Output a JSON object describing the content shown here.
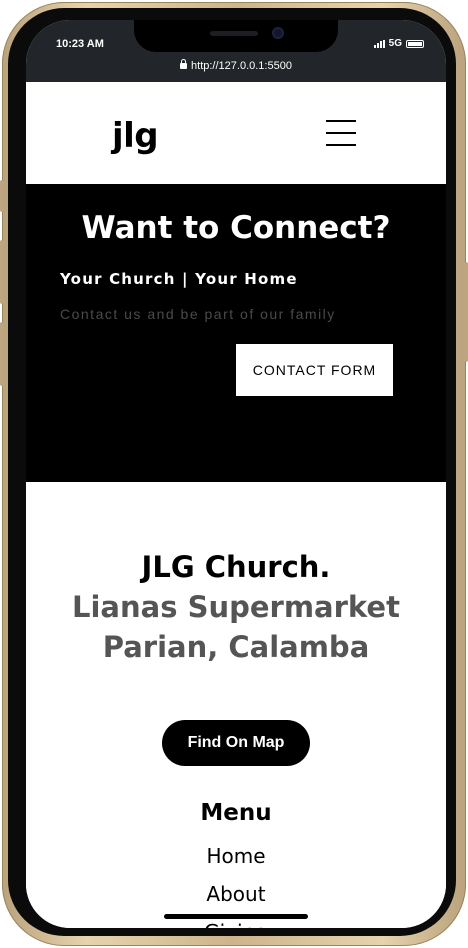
{
  "status": {
    "time": "10:23 AM",
    "network": "5G",
    "url": "http://127.0.0.1:5500"
  },
  "nav": {
    "logo": "jlg",
    "menu_icon": "hamburger-icon"
  },
  "connect": {
    "title": "Want to Connect?",
    "subtitle": "Your Church | Your Home",
    "description": "Contact us and be part of our family",
    "button_label": "CONTACT FORM"
  },
  "footer": {
    "church_name": "JLG Church.",
    "address_line1": "Lianas Supermarket",
    "address_line2": "Parian, Calamba",
    "map_button_label": "Find On Map",
    "menu_heading": "Menu",
    "menu_links": [
      "Home",
      "About",
      "Giving"
    ]
  },
  "colors": {
    "frame": "#d6c29c",
    "connect_bg": "#000000",
    "address_text": "#555555"
  }
}
